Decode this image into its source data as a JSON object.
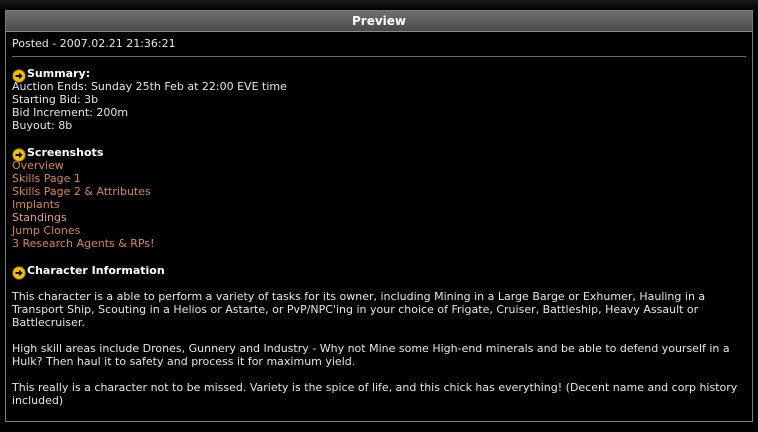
{
  "panel": {
    "title": "Preview"
  },
  "post": {
    "posted": "Posted - 2007.02.21 21:36:21"
  },
  "summary": {
    "title": "Summary:",
    "lines": [
      "Auction Ends: Sunday 25th Feb at 22:00 EVE time",
      "Starting Bid: 3b",
      "Bid Increment: 200m",
      "Buyout: 8b"
    ]
  },
  "screenshots": {
    "title": "Screenshots",
    "links": [
      "Overview",
      "Skills Page 1",
      "Skills Page 2 & Attributes",
      "Implants",
      "Standings",
      "Jump Clones",
      "3 Research Agents & RPs!"
    ]
  },
  "character": {
    "title": "Character Information",
    "paragraphs": [
      "This character is a able to perform a variety of tasks for its owner, including Mining in a Large Barge or Exhumer, Hauling in a Transport Ship, Scouting in a Helios or Astarte, or PvP/NPC'ing in your choice of Frigate, Cruiser, Battleship, Heavy Assault or Battlecruiser.",
      "High skill areas include Drones, Gunnery and Industry - Why not Mine some High-end minerals and be able to defend yourself in a Hulk? Then haul it to safety and process it for maximum yield.",
      "This really is a character not to be missed. Variety is the spice of life, and this chick has everything! (Decent name and corp history included)"
    ]
  },
  "colors": {
    "link": "#d9874b",
    "icon": "#f2c200"
  }
}
